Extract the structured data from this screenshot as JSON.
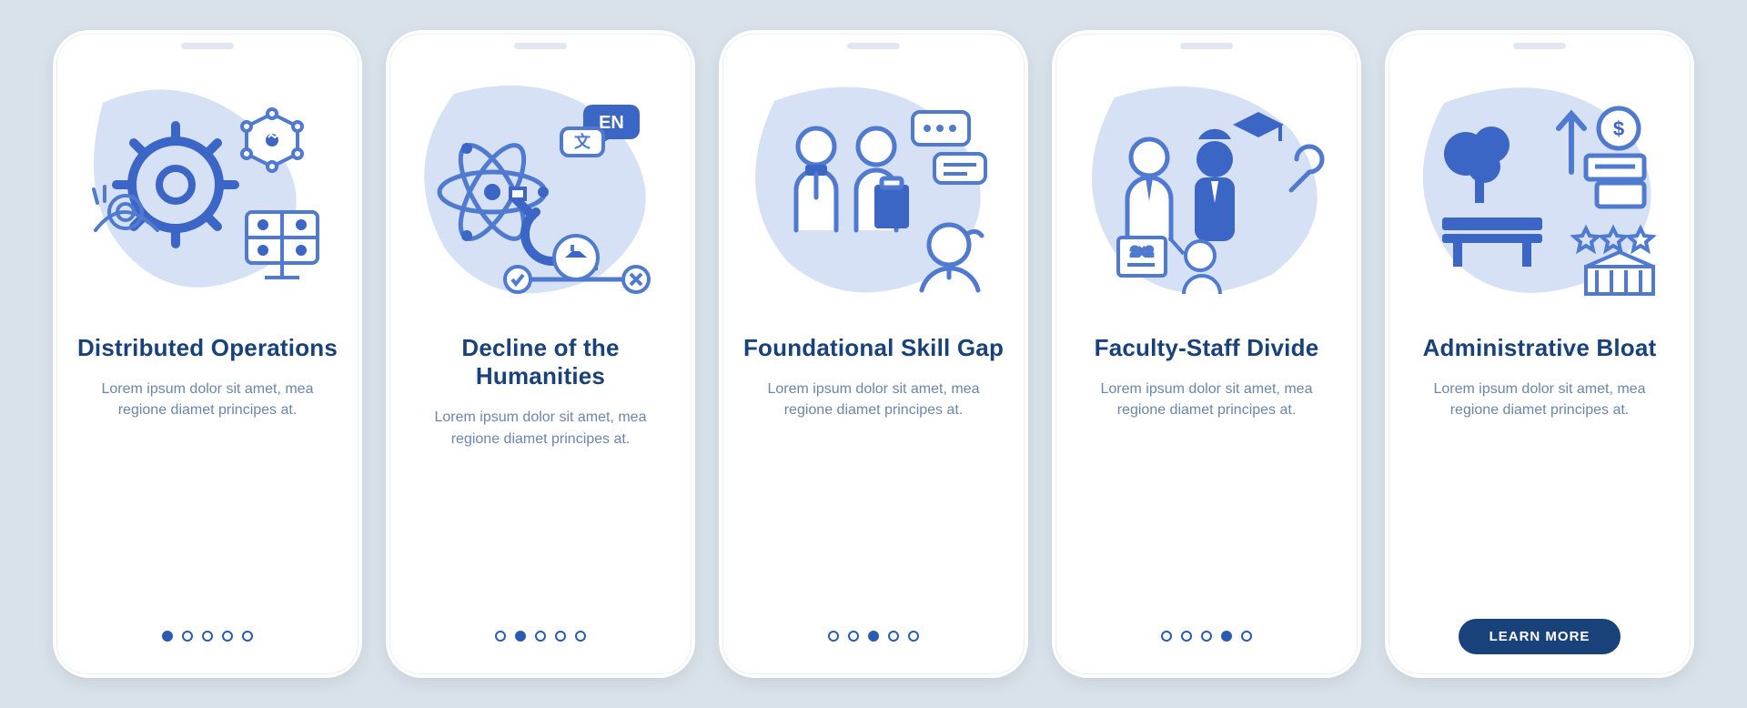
{
  "colors": {
    "background": "#d9e2ea",
    "card": "#ffffff",
    "heading": "#19427a",
    "body": "#6b86a8",
    "accent": "#2b5bb0",
    "illus_fill": "#d6e1f6",
    "illus_solid": "#3c66c5",
    "illus_stroke": "#4f7ad0"
  },
  "slides": [
    {
      "title": "Distributed Operations",
      "body": "Lorem ipsum dolor sit amet, mea regione diamet principes at.",
      "active_dot": 0,
      "icon": "distributed-operations-icon",
      "cta": null
    },
    {
      "title": "Decline of the Humanities",
      "body": "Lorem ipsum dolor sit amet, mea regione diamet principes at.",
      "active_dot": 1,
      "icon": "decline-humanities-icon",
      "cta": null
    },
    {
      "title": "Foundational Skill Gap",
      "body": "Lorem ipsum dolor sit amet, mea regione diamet principes at.",
      "active_dot": 2,
      "icon": "skill-gap-icon",
      "cta": null
    },
    {
      "title": "Faculty-Staff Divide",
      "body": "Lorem ipsum dolor sit amet, mea regione diamet principes at.",
      "active_dot": 3,
      "icon": "faculty-staff-icon",
      "cta": null
    },
    {
      "title": "Administrative Bloat",
      "body": "Lorem ipsum dolor sit amet, mea regione diamet principes at.",
      "active_dot": 4,
      "icon": "admin-bloat-icon",
      "cta": "LEARN MORE"
    }
  ],
  "dot_count": 5
}
